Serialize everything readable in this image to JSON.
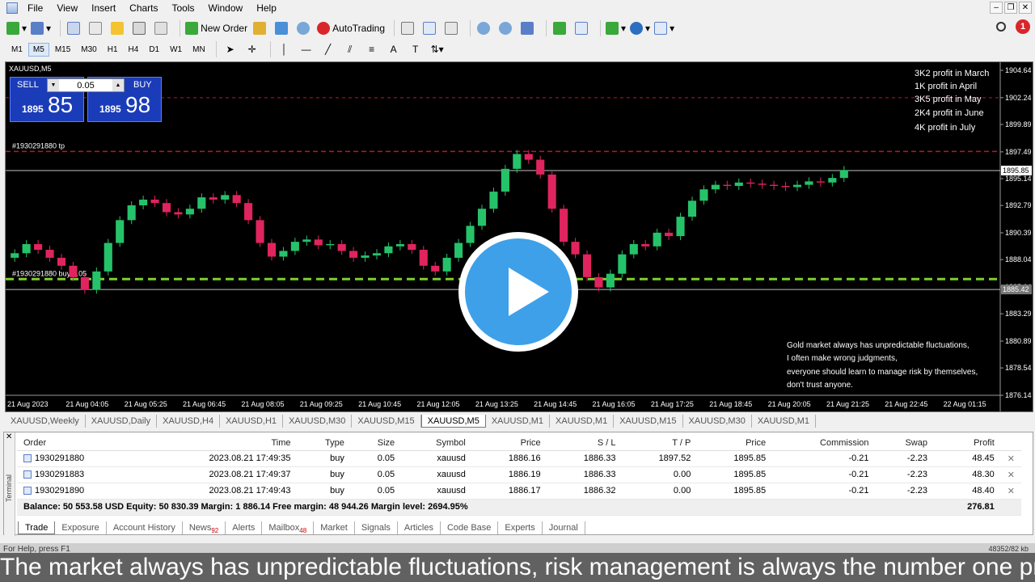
{
  "menu": [
    "File",
    "View",
    "Insert",
    "Charts",
    "Tools",
    "Window",
    "Help"
  ],
  "toolbar": {
    "new_order": "New Order",
    "autotrading": "AutoTrading",
    "alert_count": "1"
  },
  "timeframes": [
    "M1",
    "M5",
    "M15",
    "M30",
    "H1",
    "H4",
    "D1",
    "W1",
    "MN"
  ],
  "active_timeframe": "M5",
  "chart": {
    "title": "XAUUSD,M5",
    "sell_label": "SELL",
    "buy_label": "BUY",
    "lot": "0.05",
    "sell_small": "1895",
    "sell_big": "85",
    "buy_small": "1895",
    "buy_big": "98",
    "tp_label": "#1930291880 tp",
    "buy_label_line": "#1930291880 buy 0.05",
    "notes_top": [
      "3K2 profit in March",
      "1K profit in April",
      "3K5 profit in May",
      "2K4 profit in June",
      "4K profit in July"
    ],
    "notes_bottom": [
      "Gold market always has unpredictable fluctuations,",
      "I often make wrong judgments,",
      "everyone should learn to manage risk by themselves,",
      "don't trust anyone."
    ],
    "bid_label": "1895.85",
    "buy_price_label": "1885.42"
  },
  "chart_data": {
    "type": "candlestick",
    "symbol": "XAUUSD",
    "timeframe": "M5",
    "y_ticks": [
      "1904.64",
      "1902.24",
      "1899.89",
      "1897.49",
      "1895.14",
      "1892.79",
      "1890.39",
      "1888.04",
      "1885.64",
      "1883.29",
      "1880.89",
      "1878.54",
      "1876.14"
    ],
    "x_ticks": [
      "21 Aug 2023",
      "21 Aug 04:05",
      "21 Aug 05:25",
      "21 Aug 06:45",
      "21 Aug 08:05",
      "21 Aug 09:25",
      "21 Aug 10:45",
      "21 Aug 12:05",
      "21 Aug 13:25",
      "21 Aug 14:45",
      "21 Aug 16:05",
      "21 Aug 17:25",
      "21 Aug 18:45",
      "21 Aug 20:05",
      "21 Aug 21:25",
      "21 Aug 22:45",
      "22 Aug 01:15"
    ],
    "ylim": [
      1876.14,
      1904.64
    ],
    "closes": [
      1888.6,
      1889.4,
      1888.9,
      1888.2,
      1887.5,
      1886.5,
      1885.4,
      1887.0,
      1889.5,
      1891.5,
      1892.8,
      1893.3,
      1893.0,
      1892.2,
      1892.0,
      1892.5,
      1893.5,
      1893.3,
      1893.7,
      1893.0,
      1891.5,
      1889.5,
      1888.3,
      1888.8,
      1889.6,
      1889.8,
      1889.3,
      1889.4,
      1888.8,
      1888.2,
      1888.4,
      1888.6,
      1889.2,
      1889.4,
      1888.9,
      1887.5,
      1887.0,
      1888.2,
      1889.5,
      1891.0,
      1892.5,
      1894.0,
      1896.0,
      1897.3,
      1896.8,
      1895.5,
      1892.5,
      1889.6,
      1888.5,
      1886.5,
      1885.6,
      1886.8,
      1888.5,
      1889.4,
      1889.2,
      1890.4,
      1890.1,
      1891.8,
      1893.2,
      1894.2,
      1894.6,
      1894.5,
      1894.8,
      1894.7,
      1894.6,
      1894.5,
      1894.4,
      1894.6,
      1894.9,
      1894.8,
      1895.2,
      1895.9
    ],
    "price_lines": {
      "tp": 1897.52,
      "bid": 1895.85,
      "buy_entry": 1885.42,
      "sl": 1886.33
    }
  },
  "chart_tabs": [
    "XAUUSD,Weekly",
    "XAUUSD,Daily",
    "XAUUSD,H4",
    "XAUUSD,H1",
    "XAUUSD,M30",
    "XAUUSD,M15",
    "XAUUSD,M5",
    "XAUUSD,M1",
    "XAUUSD,M1",
    "XAUUSD,M15",
    "XAUUSD,M30",
    "XAUUSD,M1"
  ],
  "active_chart_tab": "XAUUSD,M5",
  "orders": {
    "headers": [
      "Order",
      "Time",
      "Type",
      "Size",
      "Symbol",
      "Price",
      "S / L",
      "T / P",
      "Price",
      "Commission",
      "Swap",
      "Profit"
    ],
    "rows": [
      [
        "1930291880",
        "2023.08.21 17:49:35",
        "buy",
        "0.05",
        "xauusd",
        "1886.16",
        "1886.33",
        "1897.52",
        "1895.85",
        "-0.21",
        "-2.23",
        "48.45"
      ],
      [
        "1930291883",
        "2023.08.21 17:49:37",
        "buy",
        "0.05",
        "xauusd",
        "1886.19",
        "1886.33",
        "0.00",
        "1895.85",
        "-0.21",
        "-2.23",
        "48.30"
      ],
      [
        "1930291890",
        "2023.08.21 17:49:43",
        "buy",
        "0.05",
        "xauusd",
        "1886.17",
        "1886.32",
        "0.00",
        "1895.85",
        "-0.21",
        "-2.23",
        "48.40"
      ]
    ],
    "balance_text": "Balance: 50 553.58 USD  Equity: 50 830.39  Margin: 1 886.14  Free margin: 48 944.26  Margin level: 2694.95%",
    "total_profit": "276.81"
  },
  "terminal_label": "Terminal",
  "terminal_tabs": [
    {
      "label": "Trade",
      "badge": ""
    },
    {
      "label": "Exposure",
      "badge": ""
    },
    {
      "label": "Account History",
      "badge": ""
    },
    {
      "label": "News",
      "badge": "92"
    },
    {
      "label": "Alerts",
      "badge": ""
    },
    {
      "label": "Mailbox",
      "badge": "48"
    },
    {
      "label": "Market",
      "badge": ""
    },
    {
      "label": "Signals",
      "badge": ""
    },
    {
      "label": "Articles",
      "badge": ""
    },
    {
      "label": "Code Base",
      "badge": ""
    },
    {
      "label": "Experts",
      "badge": ""
    },
    {
      "label": "Journal",
      "badge": ""
    }
  ],
  "status": {
    "left": "For Help, press F1",
    "right": "48352/82 kb"
  },
  "caption": "The market always has unpredictable fluctuations, risk management is always the number one priority",
  "colors": {
    "bull": "#26c26a",
    "bear": "#e0245e",
    "tp_line": "#c8102e",
    "buy_line": "#7bd12b",
    "panel_blue": "#1b3cb8",
    "play_blue": "#3ea0e8"
  }
}
